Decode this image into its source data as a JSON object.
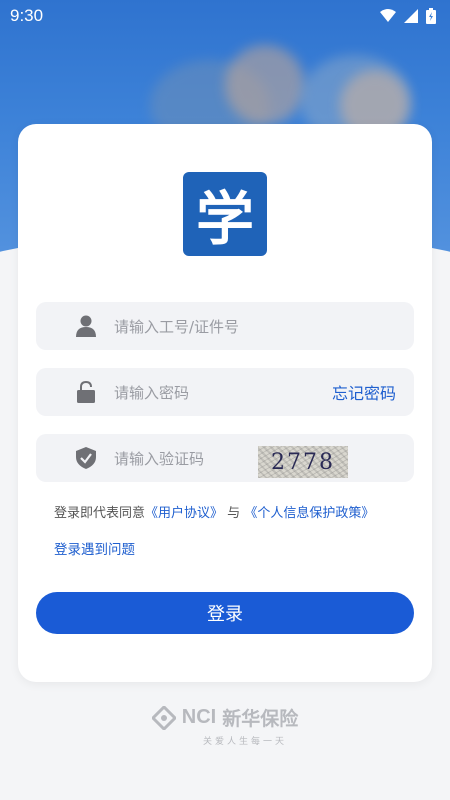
{
  "status_bar": {
    "time": "9:30"
  },
  "app": {
    "logo_char": "学"
  },
  "form": {
    "employee_id": {
      "placeholder": "请输入工号/证件号"
    },
    "password": {
      "placeholder": "请输入密码",
      "forgot_label": "忘记密码"
    },
    "captcha": {
      "placeholder": "请输入验证码",
      "captcha_text": "2778"
    }
  },
  "agreement": {
    "prefix": "登录即代表同意",
    "user_agreement": "《用户协议》",
    "conjunction": "与",
    "privacy_policy": "《个人信息保护政策》"
  },
  "trouble_link": "登录遇到问题",
  "login_button": "登录",
  "footer": {
    "brand_en": "NCI",
    "brand_cn": "新华保险",
    "slogan": "关爱人生每一天"
  },
  "colors": {
    "primary": "#1a5bd6",
    "link": "#1f5fcf",
    "logo_bg": "#1f63b8"
  }
}
